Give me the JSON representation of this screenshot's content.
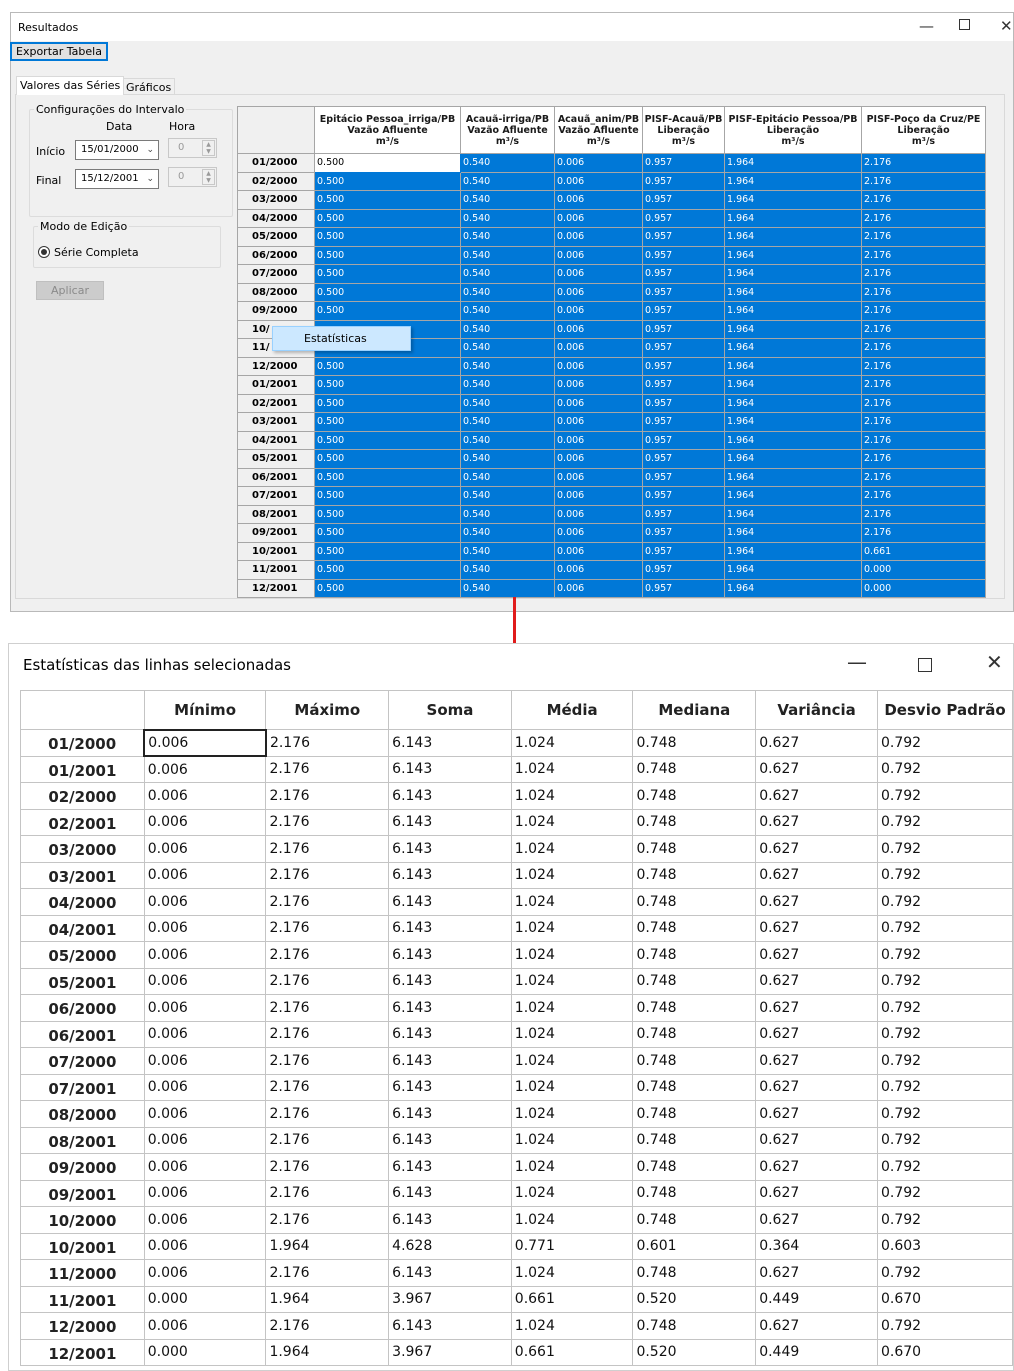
{
  "results_window": {
    "title": "Resultados",
    "export_button": "Exportar Tabela",
    "tabs": [
      "Valores das Séries",
      "Gráficos"
    ],
    "interval_group": {
      "legend": "Configurações do Intervalo",
      "date_header": "Data",
      "time_header": "Hora",
      "start_label": "Início",
      "start_date": "15/01/2000",
      "start_time": "0",
      "end_label": "Final",
      "end_date": "15/12/2001",
      "end_time": "0"
    },
    "edit_group": {
      "legend": "Modo de Edição",
      "radio_label": "Série Completa"
    },
    "apply_button": "Aplicar",
    "grid": {
      "columns": [
        {
          "name": "Epitácio Pessoa_irriga/PB",
          "type": "Vazão Afluente",
          "unit": "m³/s"
        },
        {
          "name": "Acauã-irriga/PB",
          "type": "Vazão Afluente",
          "unit": "m³/s"
        },
        {
          "name": "Acauã_anim/PB",
          "type": "Vazão Afluente",
          "unit": "m³/s"
        },
        {
          "name": "PISF-Acauã/PB",
          "type": "Liberação",
          "unit": "m³/s"
        },
        {
          "name": "PISF-Epitácio Pessoa/PB",
          "type": "Liberação",
          "unit": "m³/s"
        },
        {
          "name": "PISF-Poço da Cruz/PE",
          "type": "Liberação",
          "unit": "m³/s"
        }
      ],
      "rows": [
        {
          "label": "01/2000",
          "values": [
            "0.500",
            "0.540",
            "0.006",
            "0.957",
            "1.964",
            "2.176"
          ]
        },
        {
          "label": "02/2000",
          "values": [
            "0.500",
            "0.540",
            "0.006",
            "0.957",
            "1.964",
            "2.176"
          ]
        },
        {
          "label": "03/2000",
          "values": [
            "0.500",
            "0.540",
            "0.006",
            "0.957",
            "1.964",
            "2.176"
          ]
        },
        {
          "label": "04/2000",
          "values": [
            "0.500",
            "0.540",
            "0.006",
            "0.957",
            "1.964",
            "2.176"
          ]
        },
        {
          "label": "05/2000",
          "values": [
            "0.500",
            "0.540",
            "0.006",
            "0.957",
            "1.964",
            "2.176"
          ]
        },
        {
          "label": "06/2000",
          "values": [
            "0.500",
            "0.540",
            "0.006",
            "0.957",
            "1.964",
            "2.176"
          ]
        },
        {
          "label": "07/2000",
          "values": [
            "0.500",
            "0.540",
            "0.006",
            "0.957",
            "1.964",
            "2.176"
          ]
        },
        {
          "label": "08/2000",
          "values": [
            "0.500",
            "0.540",
            "0.006",
            "0.957",
            "1.964",
            "2.176"
          ]
        },
        {
          "label": "09/2000",
          "values": [
            "0.500",
            "0.540",
            "0.006",
            "0.957",
            "1.964",
            "2.176"
          ]
        },
        {
          "label": "10/",
          "values": [
            "",
            "0.540",
            "0.006",
            "0.957",
            "1.964",
            "2.176"
          ]
        },
        {
          "label": "11/",
          "values": [
            "",
            "0.540",
            "0.006",
            "0.957",
            "1.964",
            "2.176"
          ]
        },
        {
          "label": "12/2000",
          "values": [
            "0.500",
            "0.540",
            "0.006",
            "0.957",
            "1.964",
            "2.176"
          ]
        },
        {
          "label": "01/2001",
          "values": [
            "0.500",
            "0.540",
            "0.006",
            "0.957",
            "1.964",
            "2.176"
          ]
        },
        {
          "label": "02/2001",
          "values": [
            "0.500",
            "0.540",
            "0.006",
            "0.957",
            "1.964",
            "2.176"
          ]
        },
        {
          "label": "03/2001",
          "values": [
            "0.500",
            "0.540",
            "0.006",
            "0.957",
            "1.964",
            "2.176"
          ]
        },
        {
          "label": "04/2001",
          "values": [
            "0.500",
            "0.540",
            "0.006",
            "0.957",
            "1.964",
            "2.176"
          ]
        },
        {
          "label": "05/2001",
          "values": [
            "0.500",
            "0.540",
            "0.006",
            "0.957",
            "1.964",
            "2.176"
          ]
        },
        {
          "label": "06/2001",
          "values": [
            "0.500",
            "0.540",
            "0.006",
            "0.957",
            "1.964",
            "2.176"
          ]
        },
        {
          "label": "07/2001",
          "values": [
            "0.500",
            "0.540",
            "0.006",
            "0.957",
            "1.964",
            "2.176"
          ]
        },
        {
          "label": "08/2001",
          "values": [
            "0.500",
            "0.540",
            "0.006",
            "0.957",
            "1.964",
            "2.176"
          ]
        },
        {
          "label": "09/2001",
          "values": [
            "0.500",
            "0.540",
            "0.006",
            "0.957",
            "1.964",
            "2.176"
          ]
        },
        {
          "label": "10/2001",
          "values": [
            "0.500",
            "0.540",
            "0.006",
            "0.957",
            "1.964",
            "0.661"
          ]
        },
        {
          "label": "11/2001",
          "values": [
            "0.500",
            "0.540",
            "0.006",
            "0.957",
            "1.964",
            "0.000"
          ]
        },
        {
          "label": "12/2001",
          "values": [
            "0.500",
            "0.540",
            "0.006",
            "0.957",
            "1.964",
            "0.000"
          ]
        }
      ]
    },
    "context_menu": {
      "item": "Estatísticas"
    }
  },
  "stats_window": {
    "title": "Estatísticas das linhas selecionadas",
    "columns": [
      "Mínimo",
      "Máximo",
      "Soma",
      "Média",
      "Mediana",
      "Variância",
      "Desvio Padrão"
    ],
    "rows": [
      {
        "label": "01/2000",
        "values": [
          "0.006",
          "2.176",
          "6.143",
          "1.024",
          "0.748",
          "0.627",
          "0.792"
        ]
      },
      {
        "label": "01/2001",
        "values": [
          "0.006",
          "2.176",
          "6.143",
          "1.024",
          "0.748",
          "0.627",
          "0.792"
        ]
      },
      {
        "label": "02/2000",
        "values": [
          "0.006",
          "2.176",
          "6.143",
          "1.024",
          "0.748",
          "0.627",
          "0.792"
        ]
      },
      {
        "label": "02/2001",
        "values": [
          "0.006",
          "2.176",
          "6.143",
          "1.024",
          "0.748",
          "0.627",
          "0.792"
        ]
      },
      {
        "label": "03/2000",
        "values": [
          "0.006",
          "2.176",
          "6.143",
          "1.024",
          "0.748",
          "0.627",
          "0.792"
        ]
      },
      {
        "label": "03/2001",
        "values": [
          "0.006",
          "2.176",
          "6.143",
          "1.024",
          "0.748",
          "0.627",
          "0.792"
        ]
      },
      {
        "label": "04/2000",
        "values": [
          "0.006",
          "2.176",
          "6.143",
          "1.024",
          "0.748",
          "0.627",
          "0.792"
        ]
      },
      {
        "label": "04/2001",
        "values": [
          "0.006",
          "2.176",
          "6.143",
          "1.024",
          "0.748",
          "0.627",
          "0.792"
        ]
      },
      {
        "label": "05/2000",
        "values": [
          "0.006",
          "2.176",
          "6.143",
          "1.024",
          "0.748",
          "0.627",
          "0.792"
        ]
      },
      {
        "label": "05/2001",
        "values": [
          "0.006",
          "2.176",
          "6.143",
          "1.024",
          "0.748",
          "0.627",
          "0.792"
        ]
      },
      {
        "label": "06/2000",
        "values": [
          "0.006",
          "2.176",
          "6.143",
          "1.024",
          "0.748",
          "0.627",
          "0.792"
        ]
      },
      {
        "label": "06/2001",
        "values": [
          "0.006",
          "2.176",
          "6.143",
          "1.024",
          "0.748",
          "0.627",
          "0.792"
        ]
      },
      {
        "label": "07/2000",
        "values": [
          "0.006",
          "2.176",
          "6.143",
          "1.024",
          "0.748",
          "0.627",
          "0.792"
        ]
      },
      {
        "label": "07/2001",
        "values": [
          "0.006",
          "2.176",
          "6.143",
          "1.024",
          "0.748",
          "0.627",
          "0.792"
        ]
      },
      {
        "label": "08/2000",
        "values": [
          "0.006",
          "2.176",
          "6.143",
          "1.024",
          "0.748",
          "0.627",
          "0.792"
        ]
      },
      {
        "label": "08/2001",
        "values": [
          "0.006",
          "2.176",
          "6.143",
          "1.024",
          "0.748",
          "0.627",
          "0.792"
        ]
      },
      {
        "label": "09/2000",
        "values": [
          "0.006",
          "2.176",
          "6.143",
          "1.024",
          "0.748",
          "0.627",
          "0.792"
        ]
      },
      {
        "label": "09/2001",
        "values": [
          "0.006",
          "2.176",
          "6.143",
          "1.024",
          "0.748",
          "0.627",
          "0.792"
        ]
      },
      {
        "label": "10/2000",
        "values": [
          "0.006",
          "2.176",
          "6.143",
          "1.024",
          "0.748",
          "0.627",
          "0.792"
        ]
      },
      {
        "label": "10/2001",
        "values": [
          "0.006",
          "1.964",
          "4.628",
          "0.771",
          "0.601",
          "0.364",
          "0.603"
        ]
      },
      {
        "label": "11/2000",
        "values": [
          "0.006",
          "2.176",
          "6.143",
          "1.024",
          "0.748",
          "0.627",
          "0.792"
        ]
      },
      {
        "label": "11/2001",
        "values": [
          "0.000",
          "1.964",
          "3.967",
          "0.661",
          "0.520",
          "0.449",
          "0.670"
        ]
      },
      {
        "label": "12/2000",
        "values": [
          "0.006",
          "2.176",
          "6.143",
          "1.024",
          "0.748",
          "0.627",
          "0.792"
        ]
      },
      {
        "label": "12/2001",
        "values": [
          "0.000",
          "1.964",
          "3.967",
          "0.661",
          "0.520",
          "0.449",
          "0.670"
        ]
      }
    ]
  },
  "colors": {
    "selection": "#0078d7",
    "arrow": "#e01b1b",
    "menu_highlight": "#cce8ff"
  },
  "window_controls": {
    "minimize": "—",
    "close": "✕"
  },
  "icons": [
    "minimize-icon",
    "maximize-icon",
    "close-icon",
    "dropdown-arrow-icon",
    "spin-buttons-icon",
    "radio-selected-icon",
    "down-arrow-icon"
  ]
}
